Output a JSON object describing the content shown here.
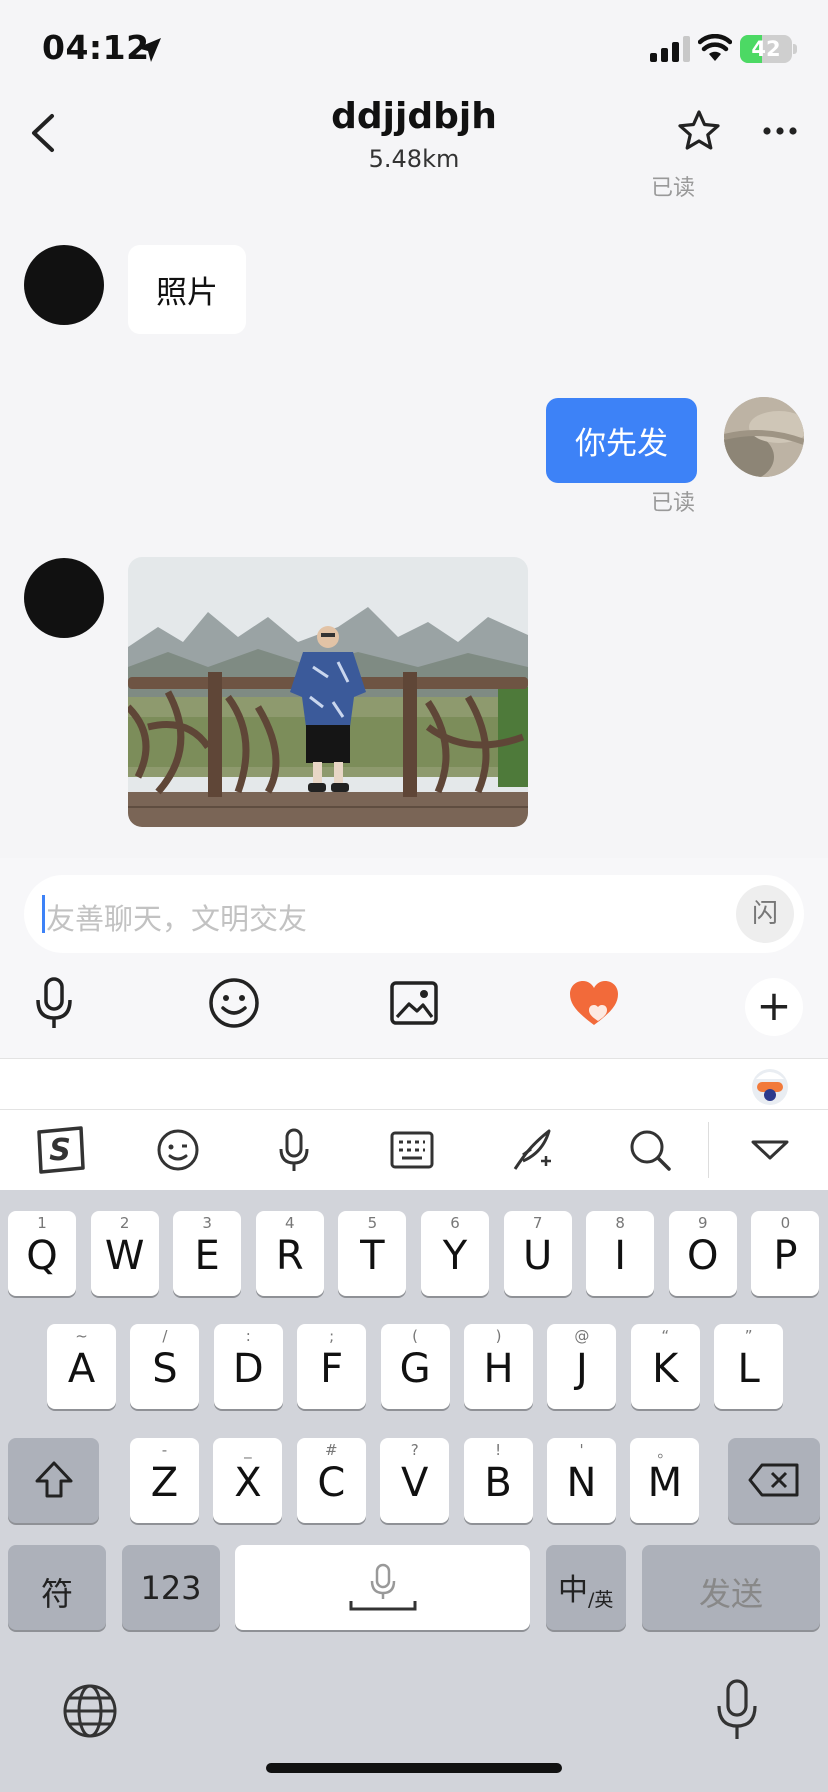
{
  "status_bar": {
    "time": "04:12",
    "battery": "42",
    "battery_level": 0.42,
    "battery_color": "#4cd964"
  },
  "header": {
    "title": "ddjjdbjh",
    "distance": "5.48km",
    "read_label": "已读",
    "icons": [
      "back-icon",
      "star-icon",
      "more-icon"
    ]
  },
  "messages": [
    {
      "from": "other",
      "type": "text",
      "text": "照片"
    },
    {
      "from": "me",
      "type": "text",
      "text": "你先发",
      "status": "已读"
    },
    {
      "from": "other",
      "type": "image"
    }
  ],
  "composer": {
    "placeholder": "友善聊天，文明交友",
    "flash_glyph": "闪",
    "toolbar_icons": [
      "microphone-icon",
      "emoji-icon",
      "image-icon",
      "heart-icon",
      "plus-icon"
    ],
    "accent": "#3d82f7"
  },
  "ime": {
    "toolbar_icons": [
      "sogou-logo-icon",
      "emoji-face-icon",
      "voice-icon",
      "keyboard-icon",
      "handwriting-icon",
      "search-icon",
      "collapse-icon"
    ],
    "row1": [
      {
        "k": "Q",
        "h": "1"
      },
      {
        "k": "W",
        "h": "2"
      },
      {
        "k": "E",
        "h": "3"
      },
      {
        "k": "R",
        "h": "4"
      },
      {
        "k": "T",
        "h": "5"
      },
      {
        "k": "Y",
        "h": "6"
      },
      {
        "k": "U",
        "h": "7"
      },
      {
        "k": "I",
        "h": "8"
      },
      {
        "k": "O",
        "h": "9"
      },
      {
        "k": "P",
        "h": "0"
      }
    ],
    "row2": [
      {
        "k": "A",
        "h": "~"
      },
      {
        "k": "S",
        "h": "/"
      },
      {
        "k": "D",
        "h": ":"
      },
      {
        "k": "F",
        "h": ";"
      },
      {
        "k": "G",
        "h": "("
      },
      {
        "k": "H",
        "h": ")"
      },
      {
        "k": "J",
        "h": "@"
      },
      {
        "k": "K",
        "h": "“"
      },
      {
        "k": "L",
        "h": "”"
      }
    ],
    "row3": [
      {
        "k": "Z",
        "h": "-"
      },
      {
        "k": "X",
        "h": "_"
      },
      {
        "k": "C",
        "h": "#"
      },
      {
        "k": "V",
        "h": "?"
      },
      {
        "k": "B",
        "h": "!"
      },
      {
        "k": "N",
        "h": "'"
      },
      {
        "k": "M",
        "h": "。"
      }
    ],
    "symbols_key": "符",
    "numbers_key": "123",
    "lang_key_main": "中",
    "lang_key_sub": "/英",
    "send_key": "发送"
  }
}
